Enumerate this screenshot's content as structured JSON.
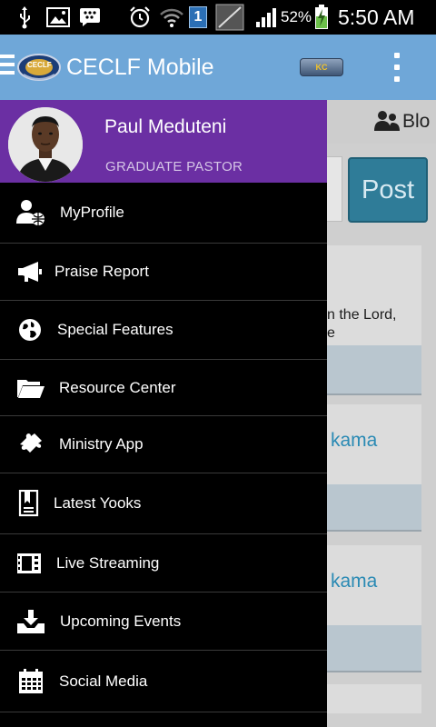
{
  "status_bar": {
    "battery": "52%",
    "time": "5:50 AM",
    "notification_count": "1",
    "icons": [
      "usb-icon",
      "image-icon",
      "blackberry-messenger-icon",
      "alarm-icon",
      "wifi-icon",
      "sim-notification-icon",
      "no-sim-icon",
      "signal-icon",
      "battery-icon"
    ]
  },
  "action_bar": {
    "title": "CECLF Mobile",
    "logo_text": "CECLF",
    "kingschat_label": "KC",
    "icons": [
      "hamburger-menu-icon",
      "app-logo",
      "kingschat-icon",
      "overflow-menu-icon"
    ]
  },
  "drawer": {
    "user": {
      "name": "Paul Meduteni",
      "role": "GRADUATE PASTOR"
    },
    "items": [
      {
        "label": "MyProfile",
        "icon": "profile-globe-icon"
      },
      {
        "label": "Praise Report",
        "icon": "megaphone-icon"
      },
      {
        "label": "Special Features",
        "icon": "globe-icon"
      },
      {
        "label": "Resource Center",
        "icon": "folder-open-icon"
      },
      {
        "label": "Ministry App",
        "icon": "puzzle-icon"
      },
      {
        "label": "Latest Yooks",
        "icon": "book-icon"
      },
      {
        "label": "Live Streaming",
        "icon": "film-icon"
      },
      {
        "label": "Upcoming Events",
        "icon": "download-tray-icon"
      },
      {
        "label": "Social Media",
        "icon": "calendar-grid-icon"
      }
    ]
  },
  "background": {
    "tab_label": "Blo",
    "post_button": "Post",
    "card1_line1": "n the Lord,",
    "card1_line2": "e",
    "card2_link": "kama",
    "card3_link": "kama"
  },
  "colors": {
    "action_bar": "#6fa7d8",
    "drawer_header": "#6b2fa3",
    "drawer_bg": "#000000",
    "post_button": "#2f7c98",
    "link": "#2a8ab4"
  }
}
